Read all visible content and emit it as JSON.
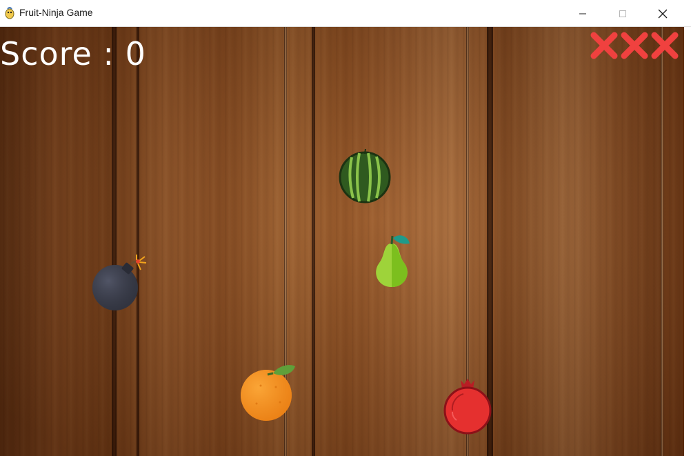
{
  "window": {
    "title": "Fruit-Ninja Game",
    "icon": "pygame-snake-icon",
    "controls": [
      "minimize-icon",
      "maximize-icon",
      "close-icon"
    ]
  },
  "hud": {
    "score_text": "Score : 0",
    "lives_lost": 3,
    "life_marker": "red-x-icon"
  },
  "objects": [
    {
      "name": "watermelon",
      "icon": "watermelon-icon"
    },
    {
      "name": "pear",
      "icon": "pear-icon"
    },
    {
      "name": "bomb",
      "icon": "bomb-icon"
    },
    {
      "name": "orange",
      "icon": "orange-icon"
    },
    {
      "name": "pomegranate",
      "icon": "pomegranate-icon"
    }
  ],
  "colors": {
    "score_text": "#ffffff",
    "life_x": "#f0413f",
    "wood": "#8e4e20"
  }
}
